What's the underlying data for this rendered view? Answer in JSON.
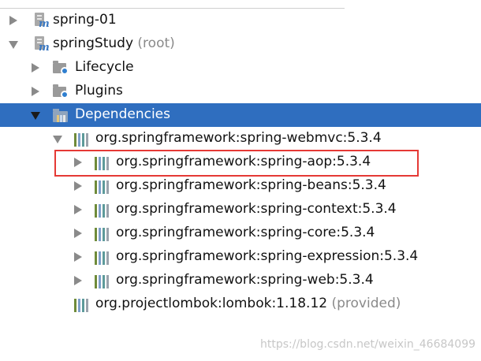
{
  "colors": {
    "selection": "#2f6ebf",
    "highlight_border": "#e53935"
  },
  "tree": {
    "module1": {
      "label": "spring-01",
      "icon": "maven-module-icon"
    },
    "module2": {
      "label": "springStudy",
      "suffix": "(root)",
      "icon": "maven-module-icon"
    },
    "lifecycle": {
      "label": "Lifecycle",
      "icon": "lifecycle-folder-icon"
    },
    "plugins": {
      "label": "Plugins",
      "icon": "plugins-folder-icon"
    },
    "dependencies": {
      "label": "Dependencies",
      "icon": "dependencies-folder-icon",
      "selected": true
    },
    "dep_webmvc": {
      "label": "org.springframework:spring-webmvc:5.3.4"
    },
    "dep_aop": {
      "label": "org.springframework:spring-aop:5.3.4"
    },
    "dep_beans": {
      "label": "org.springframework:spring-beans:5.3.4"
    },
    "dep_context": {
      "label": "org.springframework:spring-context:5.3.4"
    },
    "dep_core": {
      "label": "org.springframework:spring-core:5.3.4"
    },
    "dep_expression": {
      "label": "org.springframework:spring-expression:5.3.4"
    },
    "dep_web": {
      "label": "org.springframework:spring-web:5.3.4"
    },
    "dep_lombok": {
      "label": "org.projectlombok:lombok:1.18.12",
      "suffix": "(provided)"
    }
  },
  "watermark": "https://blog.csdn.net/weixin_46684099"
}
